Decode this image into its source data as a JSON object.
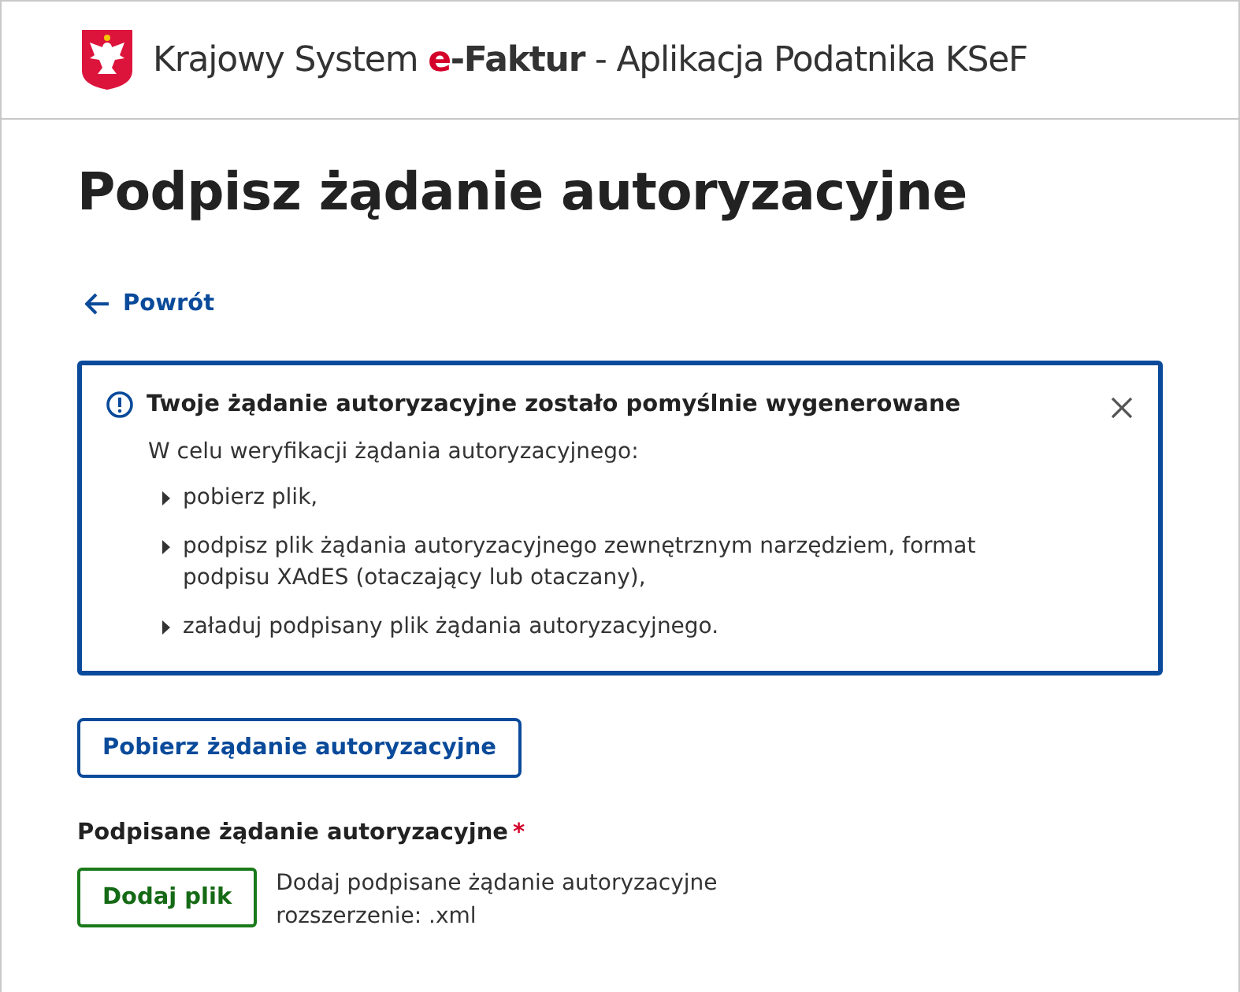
{
  "header": {
    "title_prefix": "Krajowy System",
    "brand_e": "e",
    "brand_rest": "-Faktur",
    "title_suffix": "- Aplikacja Podatnika KSeF"
  },
  "page_title": "Podpisz żądanie autoryzacyjne",
  "back_link": {
    "label": "Powrót"
  },
  "alert": {
    "title": "Twoje żądanie autoryzacyjne zostało pomyślnie wygenerowane",
    "intro": "W celu weryfikacji żądania autoryzacyjnego:",
    "items": [
      "pobierz plik,",
      "podpisz plik żądania autoryzacyjnego zewnętrznym narzędziem, format podpisu XAdES (otaczający lub otaczany),",
      "załaduj podpisany plik żądania autoryzacyjnego."
    ]
  },
  "download_button": {
    "label": "Pobierz żądanie autoryzacyjne"
  },
  "upload": {
    "label": "Podpisane żądanie autoryzacyjne",
    "required_mark": "*",
    "button": "Dodaj plik",
    "hint_lines": [
      "Dodaj podpisane żądanie autoryzacyjne",
      "rozszerzenie: .xml"
    ]
  }
}
